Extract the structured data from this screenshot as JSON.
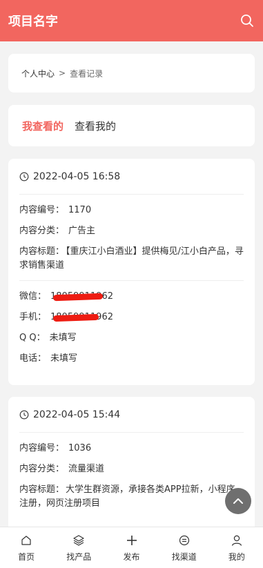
{
  "header": {
    "title": "项目名字",
    "search_icon": "search-icon"
  },
  "breadcrumb": {
    "home": "个人中心",
    "separator": ">",
    "current": "查看记录"
  },
  "tabs": [
    {
      "label": "我查看的",
      "active": true
    },
    {
      "label": "查看我的",
      "active": false
    }
  ],
  "records": [
    {
      "time": "2022-04-05 16:58",
      "content_id_label": "内容编号：",
      "content_id": "1170",
      "category_label": "内容分类：",
      "category": "广告主",
      "title_label": "内容标题：",
      "title": "【重庆江小白酒业】提供梅见/江小白产品，寻求销售渠道",
      "wechat_label": "微信：",
      "wechat": "18059911962",
      "phone_label": "手机：",
      "phone": "18059911962",
      "qq_label": "Q Q：",
      "qq": "未填写",
      "tel_label": "电话：",
      "tel": "未填写"
    },
    {
      "time": "2022-04-05 15:44",
      "content_id_label": "内容编号：",
      "content_id": "1036",
      "category_label": "内容分类：",
      "category": "流量渠道",
      "title_label": "内容标题：",
      "title": "大学生群资源，承接各类APP拉新，小程序注册，网页注册项目"
    }
  ],
  "tabbar": [
    {
      "label": "首页",
      "icon": "home-icon"
    },
    {
      "label": "找产品",
      "icon": "layers-icon"
    },
    {
      "label": "发布",
      "icon": "plus-icon"
    },
    {
      "label": "找渠道",
      "icon": "channel-icon"
    },
    {
      "label": "我的",
      "icon": "user-icon"
    }
  ],
  "colors": {
    "brand": "#f2665f",
    "redact": "#ee1c12"
  }
}
